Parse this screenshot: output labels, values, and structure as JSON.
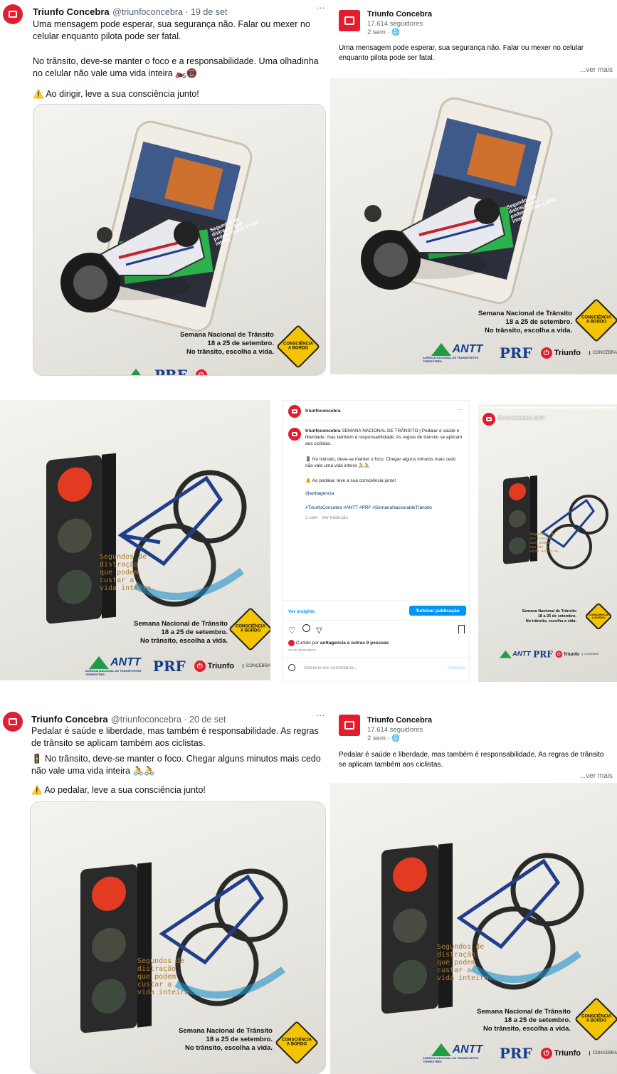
{
  "post1_twitter": {
    "name": "Triunfo Concebra",
    "handle": "@triunfoconcebra · 19 de set",
    "text1": "Uma mensagem pode esperar, sua segurança não. Falar ou mexer no celular enquanto pilota pode ser fatal.",
    "text2": "No trânsito, deve-se manter o foco e a responsabilidade. Uma olhadinha no celular não vale uma vida inteira 🏍️📵",
    "text3": "⚠️ Ao dirigir, leve a sua consciência junto!",
    "more": "···"
  },
  "post1_facebook": {
    "name": "Triunfo Concebra",
    "followers": "17.614 seguidores",
    "time": "2 sem · 🌐",
    "text": "Uma mensagem pode esperar, sua segurança não. Falar ou mexer no celular enquanto pilota pode ser fatal.",
    "see_more": "...ver mais"
  },
  "campaign": {
    "line1": "Semana Nacional de Trânsito",
    "line2": "18 a 25 de setembro.",
    "line3": "No trânsito, escolha a vida.",
    "sign": "CONSCIÊNCIA\nA BORDO",
    "phone_text": "Segundos de distração que podem custar a vida inteira",
    "bike_text": "Segundos de\ndistração\nque podem\ncustar a\nvida inteira.",
    "antt": "ANTT",
    "antt_sub": "AGÊNCIA NACIONAL DE TRANSPORTES TERRESTRES",
    "prf": "PRF",
    "triunfo": "Triunfo",
    "concebra": "CONCEBRA"
  },
  "instagram": {
    "user": "triunfoconcebra",
    "caption_user": "triunfoconcebra",
    "caption": "SEMANA NACIONAL DE TRÂNSITO | Pedalar é saúde e liberdade, mas também é responsabilidade. As regras de trânsito se aplicam aos ciclistas.",
    "line2": "🚦 No trânsito, deve-se manter o foco. Chegar alguns minutos mais cedo não vale uma vida inteira 🚴🚴",
    "line3": "⚠️ Ao pedalar, leve a sua consciência junto!",
    "mention": "@anttagencia",
    "hashtags": "#TriunfoConcebra #ANTT #PRF #SemanaNacionaldeTrânsito",
    "meta": "2 sem   Ver tradução",
    "insights": "Ver insights",
    "boost": "Turbinar publicação",
    "liked_prefix": "Curtido por ",
    "liked_names": "anttagencia e outras 9 pessoas",
    "date": "20 DE SETEMBRO",
    "comment_placeholder": "Adicione um comentário...",
    "publish": "Publicar",
    "dots": "···"
  },
  "story": {
    "date": "20 de setembro",
    "time": "11:57"
  },
  "post2_twitter": {
    "name": "Triunfo Concebra",
    "handle": "@triunfoconcebra · 20 de set",
    "text1": "Pedalar é saúde e liberdade, mas também é responsabilidade. As regras de trânsito se aplicam também aos ciclistas.",
    "text2": "🚦 No trânsito, deve-se manter o foco. Chegar alguns minutos mais cedo não vale uma vida inteira 🚴🚴",
    "text3": "⚠️ Ao pedalar, leve a sua consciência junto!",
    "more": "···"
  },
  "post2_facebook": {
    "name": "Triunfo Concebra",
    "followers": "17.614 seguidores",
    "time": "2 sem · 🌐",
    "text": "Pedalar é saúde e liberdade, mas também é responsabilidade. As regras de trânsito se aplicam também aos ciclistas.",
    "see_more": "...ver mais"
  },
  "colors": {
    "brand_red": "#e11d2f",
    "ig_blue": "#0095f6",
    "sign_yellow": "#f5c400",
    "antt_green": "#1f9d45",
    "prf_blue": "#143d8c"
  }
}
